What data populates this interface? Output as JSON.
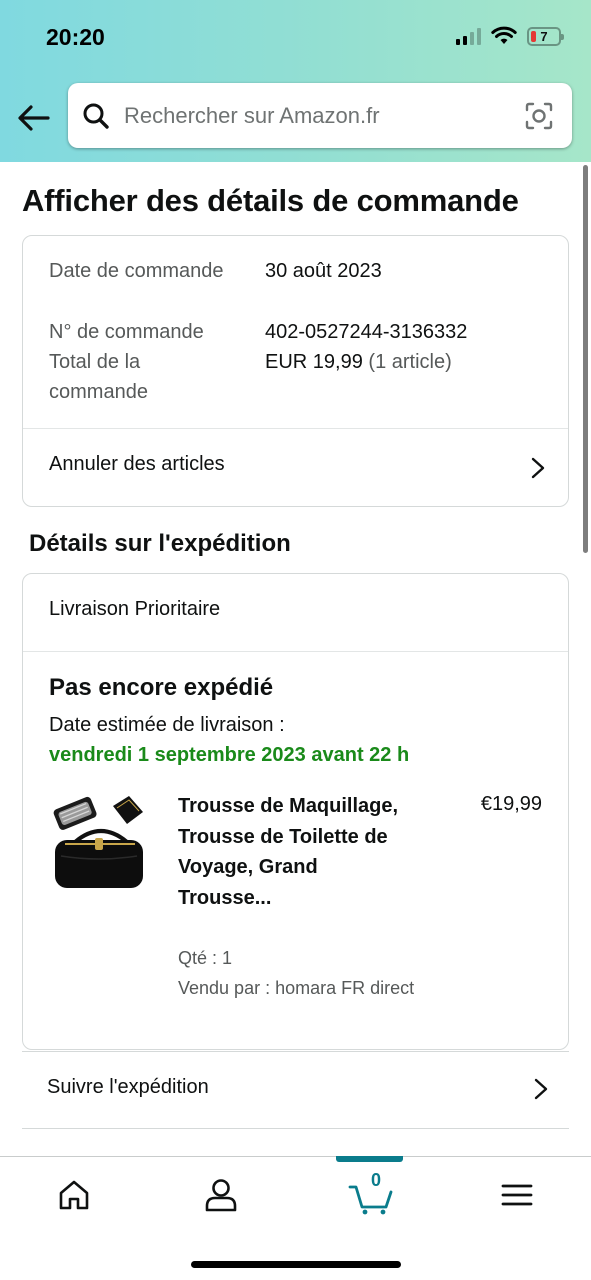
{
  "status_bar": {
    "time": "20:20",
    "battery": "7"
  },
  "search": {
    "placeholder": "Rechercher sur Amazon.fr"
  },
  "page": {
    "title": "Afficher des détails de commande"
  },
  "order_summary": {
    "date_label": "Date de commande",
    "date_value": "30 août 2023",
    "number_label": "N° de commande",
    "number_value": "402-0527244-3136332",
    "total_label": "Total de la commande",
    "total_value": "EUR 19,99",
    "total_items": "(1 article)",
    "cancel_link": "Annuler des articles"
  },
  "shipping": {
    "section_title": "Détails sur l'expédition",
    "method": "Livraison Prioritaire",
    "status": "Pas encore expédié",
    "delivery_label": "Date estimée de livraison :",
    "delivery_date": "vendredi 1 septembre 2023 avant 22 h",
    "delivery_date_color": "#1a8a1a",
    "item": {
      "title": "Trousse de Maquillage, Trousse de Toilette de Voyage, Grand Trousse...",
      "price": "€19,99",
      "quantity": "Qté : 1",
      "seller": "Vendu par : homara FR direct"
    },
    "track_link": "Suivre l'expédition"
  },
  "bottom_nav": {
    "items": [
      "home-icon",
      "account-icon",
      "cart-icon",
      "menu-icon"
    ],
    "cart_count": "0",
    "active": "cart",
    "accent": "#0a7c8c"
  }
}
